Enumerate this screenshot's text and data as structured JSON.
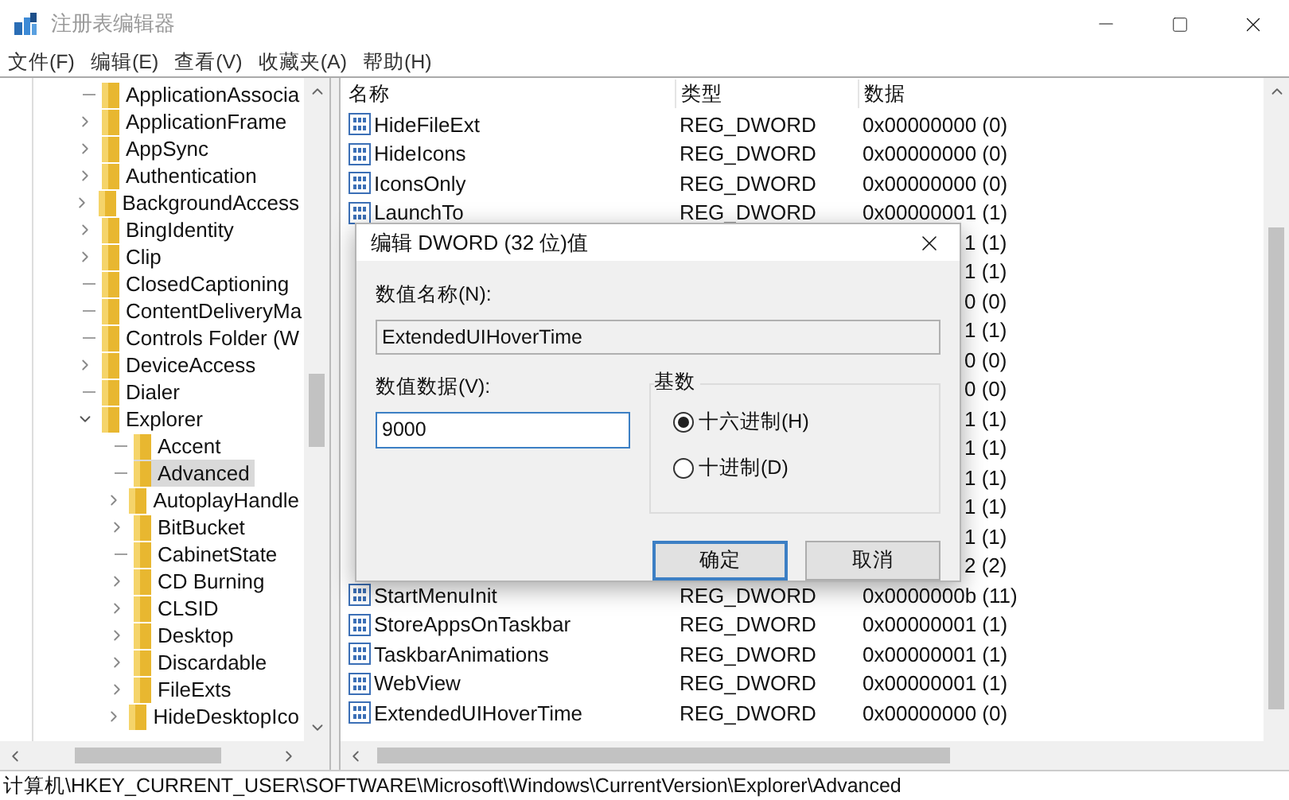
{
  "window": {
    "title": "注册表编辑器"
  },
  "menu": [
    "文件(F)",
    "编辑(E)",
    "查看(V)",
    "收藏夹(A)",
    "帮助(H)"
  ],
  "tree": {
    "items": [
      {
        "label": "ApplicationAssocia",
        "expandable": false,
        "selected": false
      },
      {
        "label": "ApplicationFrame",
        "expandable": true,
        "expanded": false,
        "selected": false
      },
      {
        "label": "AppSync",
        "expandable": true,
        "expanded": false,
        "selected": false
      },
      {
        "label": "Authentication",
        "expandable": true,
        "expanded": false,
        "selected": false
      },
      {
        "label": "BackgroundAccess",
        "expandable": true,
        "expanded": false,
        "selected": false
      },
      {
        "label": "BingIdentity",
        "expandable": true,
        "expanded": false,
        "selected": false
      },
      {
        "label": "Clip",
        "expandable": true,
        "expanded": false,
        "selected": false
      },
      {
        "label": "ClosedCaptioning",
        "expandable": false,
        "selected": false
      },
      {
        "label": "ContentDeliveryMa",
        "expandable": false,
        "selected": false
      },
      {
        "label": "Controls Folder (W",
        "expandable": false,
        "selected": false
      },
      {
        "label": "DeviceAccess",
        "expandable": true,
        "expanded": false,
        "selected": false
      },
      {
        "label": "Dialer",
        "expandable": false,
        "selected": false
      },
      {
        "label": "Explorer",
        "expandable": true,
        "expanded": true,
        "selected": false,
        "children": [
          {
            "label": "Accent",
            "expandable": false,
            "selected": false
          },
          {
            "label": "Advanced",
            "expandable": false,
            "selected": true
          },
          {
            "label": "AutoplayHandle",
            "expandable": true,
            "expanded": false,
            "selected": false
          },
          {
            "label": "BitBucket",
            "expandable": true,
            "expanded": false,
            "selected": false
          },
          {
            "label": "CabinetState",
            "expandable": false,
            "selected": false
          },
          {
            "label": "CD Burning",
            "expandable": true,
            "expanded": false,
            "selected": false
          },
          {
            "label": "CLSID",
            "expandable": true,
            "expanded": false,
            "selected": false
          },
          {
            "label": "Desktop",
            "expandable": true,
            "expanded": false,
            "selected": false
          },
          {
            "label": "Discardable",
            "expandable": true,
            "expanded": false,
            "selected": false
          },
          {
            "label": "FileExts",
            "expandable": true,
            "expanded": false,
            "selected": false
          },
          {
            "label": "HideDesktopIco",
            "expandable": true,
            "expanded": false,
            "selected": false
          }
        ]
      }
    ]
  },
  "list": {
    "columns": [
      "名称",
      "类型",
      "数据"
    ],
    "rows": [
      {
        "kind": "value",
        "name": "HideFileExt",
        "type": "REG_DWORD",
        "data": "0x00000000 (0)"
      },
      {
        "kind": "value",
        "name": "HideIcons",
        "type": "REG_DWORD",
        "data": "0x00000000 (0)"
      },
      {
        "kind": "value",
        "name": "IconsOnly",
        "type": "REG_DWORD",
        "data": "0x00000000 (0)"
      },
      {
        "kind": "value",
        "name": "LaunchTo",
        "type": "REG_DWORD",
        "data": "0x00000001 (1)"
      },
      {
        "kind": "covered",
        "data": "1 (1)"
      },
      {
        "kind": "covered",
        "data": "1 (1)"
      },
      {
        "kind": "covered",
        "data": "0 (0)"
      },
      {
        "kind": "covered",
        "data": "1 (1)"
      },
      {
        "kind": "covered",
        "data": "0 (0)"
      },
      {
        "kind": "covered",
        "data": "0 (0)"
      },
      {
        "kind": "covered",
        "data": "1 (1)"
      },
      {
        "kind": "covered",
        "data": "1 (1)"
      },
      {
        "kind": "covered",
        "data": "1 (1)"
      },
      {
        "kind": "covered",
        "data": "1 (1)"
      },
      {
        "kind": "covered",
        "data": "1 (1)"
      },
      {
        "kind": "covered",
        "data": "2 (2)"
      },
      {
        "kind": "value",
        "name": "StartMenuInit",
        "type": "REG_DWORD",
        "data": "0x0000000b (11)"
      },
      {
        "kind": "value",
        "name": "StoreAppsOnTaskbar",
        "type": "REG_DWORD",
        "data": "0x00000001 (1)"
      },
      {
        "kind": "value",
        "name": "TaskbarAnimations",
        "type": "REG_DWORD",
        "data": "0x00000001 (1)"
      },
      {
        "kind": "value",
        "name": "WebView",
        "type": "REG_DWORD",
        "data": "0x00000001 (1)"
      },
      {
        "kind": "value",
        "name": "ExtendedUIHoverTime",
        "type": "REG_DWORD",
        "data": "0x00000000 (0)"
      }
    ]
  },
  "dialog": {
    "title": "编辑 DWORD (32 位)值",
    "name_label": "数值名称(N):",
    "name_value": "ExtendedUIHoverTime",
    "data_label": "数值数据(V):",
    "data_value": "9000",
    "base_label": "基数",
    "bases": [
      {
        "label": "十六进制(H)",
        "selected": true
      },
      {
        "label": "十进制(D)",
        "selected": false
      }
    ],
    "buttons": [
      {
        "label": "确定",
        "default": true
      },
      {
        "label": "取消",
        "default": false
      }
    ]
  },
  "status_bar": "计算机\\HKEY_CURRENT_USER\\SOFTWARE\\Microsoft\\Windows\\CurrentVersion\\Explorer\\Advanced"
}
